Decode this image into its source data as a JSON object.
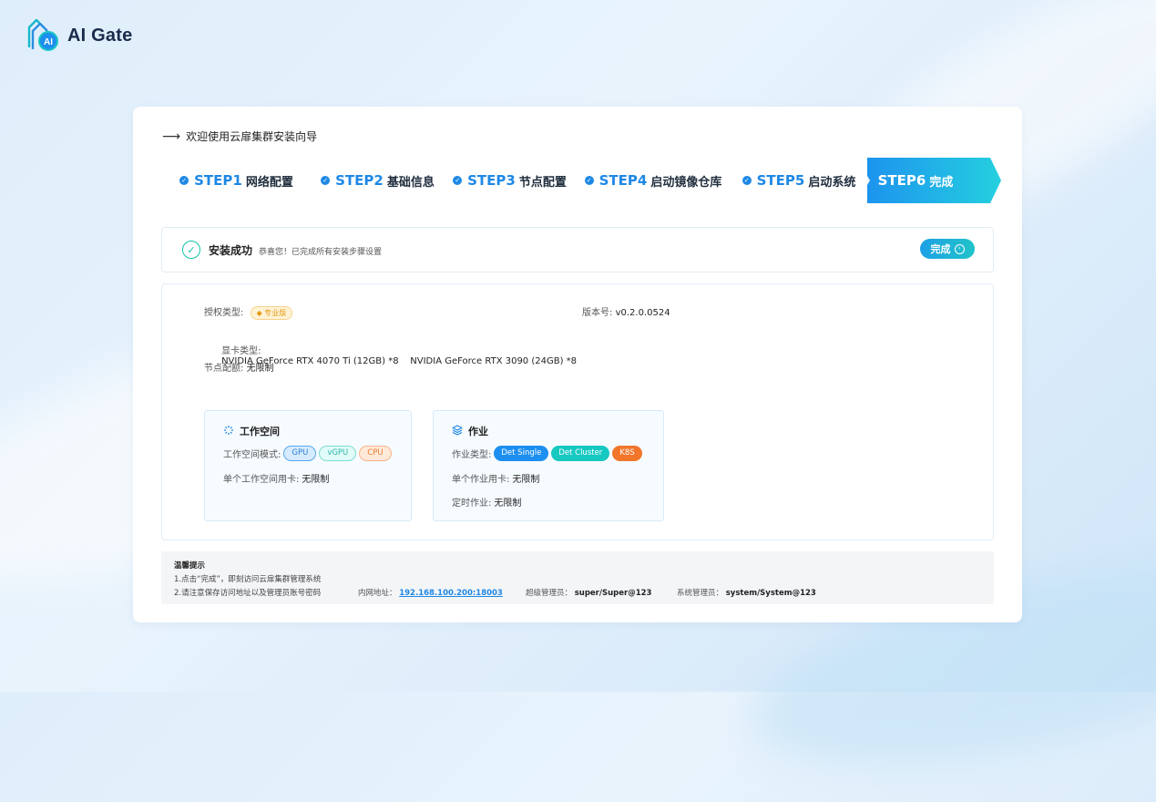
{
  "app": {
    "logo_text": "AI Gate"
  },
  "wizard": {
    "title": "欢迎使用云扉集群安装向导"
  },
  "steps": [
    {
      "num": "STEP1",
      "label": "网络配置",
      "status": "done"
    },
    {
      "num": "STEP2",
      "label": "基础信息",
      "status": "done"
    },
    {
      "num": "STEP3",
      "label": "节点配置",
      "status": "done"
    },
    {
      "num": "STEP4",
      "label": "启动镜像仓库",
      "status": "done"
    },
    {
      "num": "STEP5",
      "label": "启动系统",
      "status": "done"
    },
    {
      "num": "STEP6",
      "label": "完成",
      "status": "active"
    }
  ],
  "success": {
    "title": "安装成功",
    "subtitle": "恭喜您！已完成所有安装步骤设置",
    "button": "完成"
  },
  "info": {
    "license_label": "授权类型:",
    "license_badge": "专业版",
    "version_label": "版本号:",
    "version_value": "v0.2.0.0524",
    "gpu_label": "显卡类型:",
    "gpu_value": "NVIDIA GeForce RTX 4070 Ti (12GB) *8    NVIDIA GeForce RTX 3090 (24GB) *8",
    "quota_label": "节点配额:",
    "quota_value": "无限制"
  },
  "workspace": {
    "title": "工作空间",
    "mode_label": "工作空间模式:",
    "modes": [
      "GPU",
      "vGPU",
      "CPU"
    ],
    "card_label": "单个工作空间用卡:",
    "card_value": "无限制"
  },
  "job": {
    "title": "作业",
    "type_label": "作业类型:",
    "types": [
      "Det Single",
      "Det Cluster",
      "K8S"
    ],
    "card_label": "单个作业用卡:",
    "card_value": "无限制",
    "cron_label": "定时作业:",
    "cron_value": "无限制"
  },
  "tips": {
    "title": "温馨提示",
    "line1": "1.点击“完成”，即刻访问云扉集群管理系统",
    "line2": "2.请注意保存访问地址以及管理员账号密码",
    "addr_label": "内网地址：",
    "addr_value": "192.168.100.200:18003",
    "super_label": "超级管理员：",
    "super_value": "super/Super@123",
    "sys_label": "系统管理员：",
    "sys_value": "system/System@123"
  },
  "colors": {
    "primary": "#1e88e5",
    "accent": "#20c3c9",
    "success": "#13c2a8"
  }
}
